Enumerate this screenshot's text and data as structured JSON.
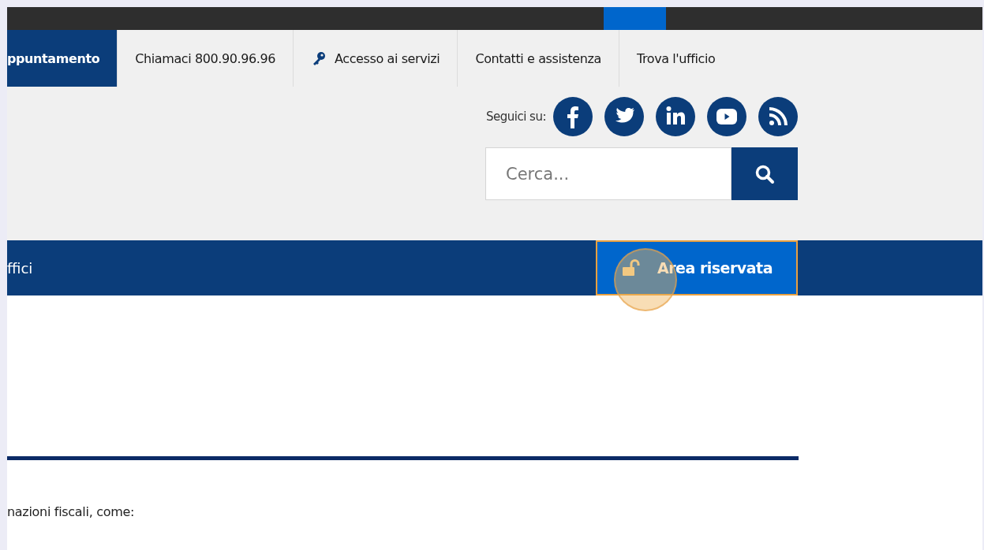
{
  "top_nav": [
    {
      "label": "ppuntamento",
      "selected": true,
      "kind": "text"
    },
    {
      "label": "Chiamaci 800.90.96.96",
      "selected": false,
      "kind": "text"
    },
    {
      "label": "Accesso ai servizi",
      "selected": false,
      "kind": "key"
    },
    {
      "label": "Contatti e assistenza",
      "selected": false,
      "kind": "text"
    },
    {
      "label": "Trova l'ufficio",
      "selected": false,
      "kind": "text"
    }
  ],
  "social": {
    "label": "Seguici su:",
    "icons": [
      {
        "kind": "facebook"
      },
      {
        "kind": "twitter"
      },
      {
        "kind": "linkedin"
      },
      {
        "kind": "youtube"
      },
      {
        "kind": "rss"
      }
    ]
  },
  "search": {
    "placeholder": "Cerca..."
  },
  "main_menu": {
    "item": "ffici",
    "reserved_area": "Area riservata"
  },
  "body_text": "nazioni fiscali, come:"
}
